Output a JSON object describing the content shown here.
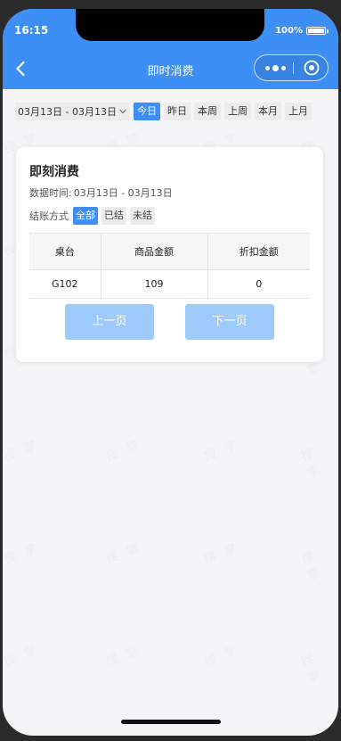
{
  "status_bar": {
    "time": "16:15",
    "battery": "100%"
  },
  "nav": {
    "title": "即时消费"
  },
  "filter": {
    "date_range": "03月13日 - 03月13日",
    "periods": [
      "今日",
      "昨日",
      "本周",
      "上周",
      "本月",
      "上月"
    ],
    "active_period": "今日"
  },
  "card": {
    "title": "即刻消费",
    "time_label": "数据时间:",
    "time_value": "03月13日 - 03月13日",
    "settle_label": "结账方式",
    "settle_options": [
      "全部",
      "已结",
      "未结"
    ],
    "active_settle": "全部",
    "table": {
      "columns": [
        "桌台",
        "商品金额",
        "折扣金额"
      ],
      "rows": [
        [
          "G102",
          "109",
          "0"
        ]
      ]
    },
    "prev_label": "上一页",
    "next_label": "下一页"
  },
  "watermark_text": "搜 掌",
  "colors": {
    "accent": "#3d8ff5",
    "pager": "#9ecbfb"
  }
}
